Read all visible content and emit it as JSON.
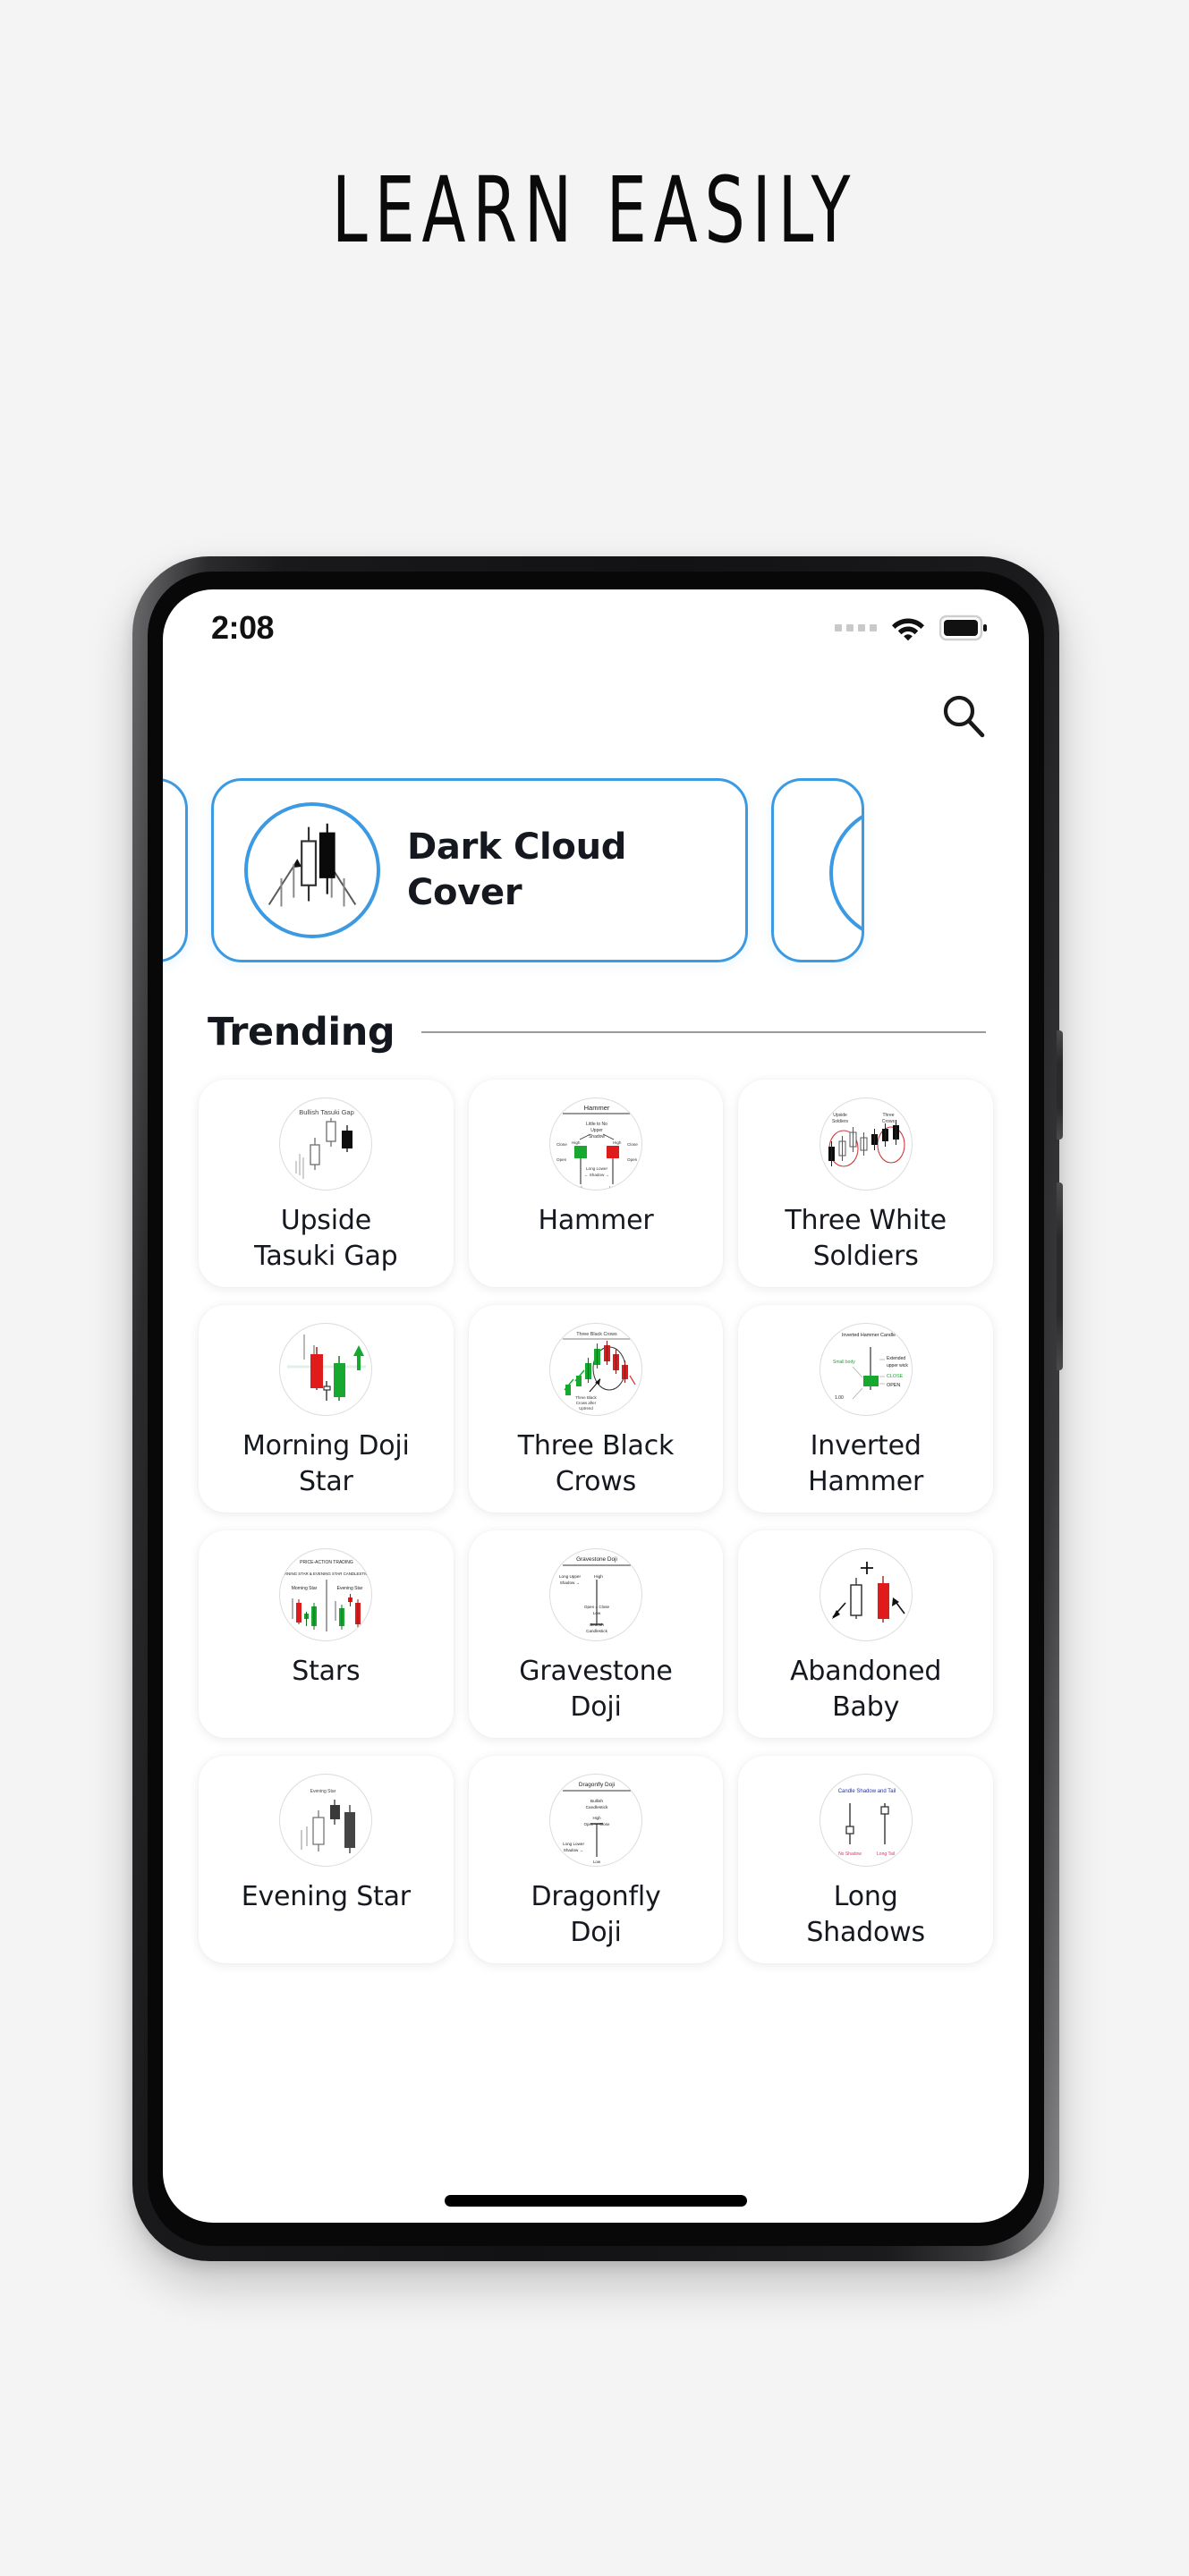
{
  "headline": "LEARN EASILY",
  "status_bar": {
    "time": "2:08",
    "signal_icon": "signal-dots-icon",
    "wifi_icon": "wifi-icon",
    "battery_icon": "battery-full-icon"
  },
  "app_bar": {
    "search_icon": "search-icon"
  },
  "carousel": {
    "featured": {
      "title_line_1": "Dark Cloud",
      "title_line_2": "Cover",
      "thumb_icon": "dark-cloud-cover-chart-icon",
      "accent_color": "#3c9ae3"
    },
    "peek_left_label": "",
    "peek_right_label": ""
  },
  "trending": {
    "title": "Trending",
    "items": [
      {
        "label_line_1": "Upside",
        "label_line_2": "Tasuki Gap",
        "thumb": "upside-tasuki-gap-chart"
      },
      {
        "label_line_1": "Hammer",
        "label_line_2": "",
        "thumb": "hammer-chart"
      },
      {
        "label_line_1": "Three White",
        "label_line_2": "Soldiers",
        "thumb": "three-white-soldiers-chart"
      },
      {
        "label_line_1": "Morning Doji",
        "label_line_2": "Star",
        "thumb": "morning-doji-star-chart"
      },
      {
        "label_line_1": "Three Black",
        "label_line_2": "Crows",
        "thumb": "three-black-crows-chart"
      },
      {
        "label_line_1": "Inverted",
        "label_line_2": "Hammer",
        "thumb": "inverted-hammer-chart"
      },
      {
        "label_line_1": "Stars",
        "label_line_2": "",
        "thumb": "stars-chart"
      },
      {
        "label_line_1": "Gravestone",
        "label_line_2": "Doji",
        "thumb": "gravestone-doji-chart"
      },
      {
        "label_line_1": "Abandoned",
        "label_line_2": "Baby",
        "thumb": "abandoned-baby-chart"
      },
      {
        "label_line_1": "Evening Star",
        "label_line_2": "",
        "thumb": "evening-star-chart"
      },
      {
        "label_line_1": "Dragonfly",
        "label_line_2": "Doji",
        "thumb": "dragonfly-doji-chart"
      },
      {
        "label_line_1": "Long",
        "label_line_2": "Shadows",
        "thumb": "long-shadows-chart"
      }
    ]
  },
  "thumb_captions": {
    "upside_tasuki_gap": "Bullish Tasuki Gap",
    "hammer": "Hammer",
    "hammer_parts": [
      "Little to No",
      "Upper",
      "Shadow",
      "Close",
      "High",
      "High",
      "Open",
      "Open",
      "Close",
      "Long Lower",
      "Shadow",
      "Low",
      "Low"
    ],
    "three_white_soldiers": [
      "Upside",
      "Soldiers",
      "Three",
      "Crows"
    ],
    "three_black_crows": [
      "Three Black Crows",
      "Three Black Crows after Uptrend"
    ],
    "inverted_hammer": [
      "Inverted Hammer Candlestick",
      "Small body",
      "Extended",
      "upper wick",
      "CLOSE",
      "OPEN"
    ],
    "stars": [
      "PRICE ACTION TRADING",
      "MORNING STAR & EVENING STAR CANDLESTICK PATTERN",
      "Morning Star",
      "Evening Star"
    ],
    "gravestone_doji": [
      "Gravestone Doji",
      "High",
      "Long Upper",
      "Shadow",
      "Open = Close",
      "Low",
      "Bearish Candlestick"
    ],
    "dragonfly_doji": [
      "Dragonfly Doji",
      "Bullish",
      "Candlestick",
      "High",
      "Open = Close",
      "Long Lower",
      "Shadow",
      "Low"
    ],
    "long_shadows": [
      "Candle Shadow and Tail",
      "No Shadow",
      "Long Tail"
    ],
    "evening_star": "Evening Star"
  },
  "home_indicator": "home-indicator"
}
